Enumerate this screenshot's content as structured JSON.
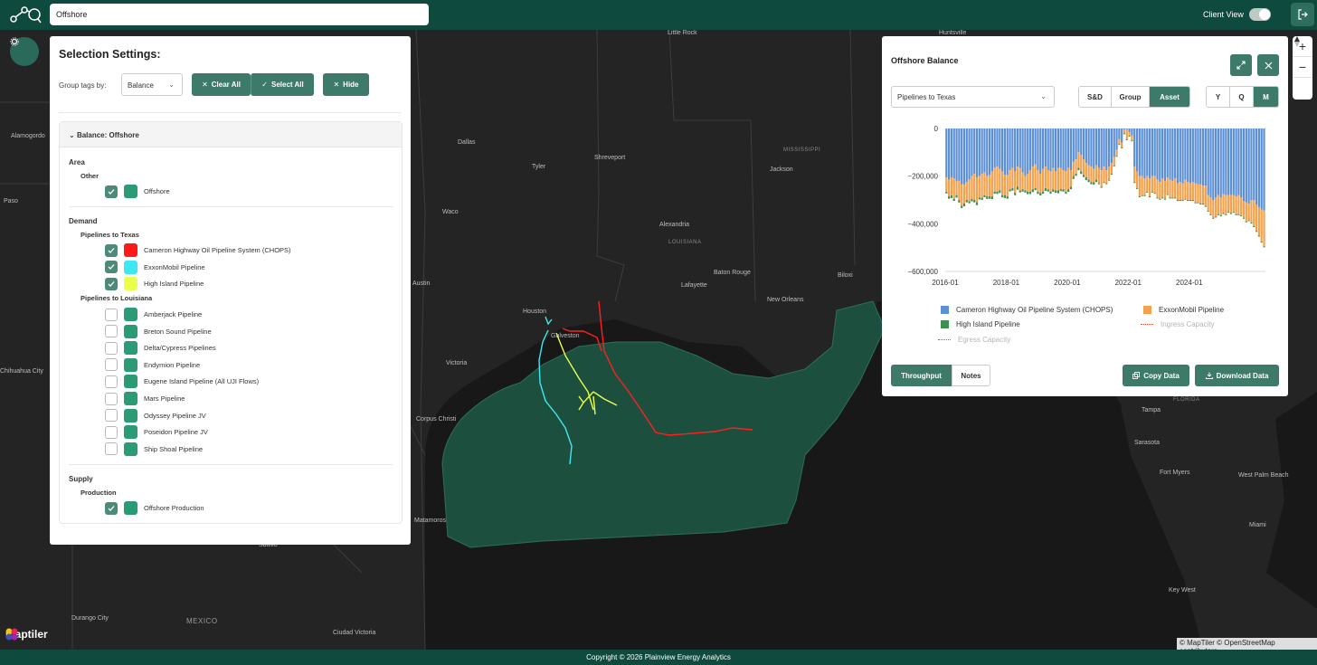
{
  "topbar": {
    "search_value": "Offshore",
    "client_view_label": "Client View",
    "client_view_on": true
  },
  "map": {
    "places": [
      {
        "name": "Little Rock",
        "x": 738,
        "y": 0
      },
      {
        "name": "Huntsville",
        "x": 1038,
        "y": 0
      },
      {
        "name": "Alamogordo",
        "x": 12,
        "y": 114
      },
      {
        "name": "Paso",
        "x": 4,
        "y": 186
      },
      {
        "name": "Dallas",
        "x": 506,
        "y": 121
      },
      {
        "name": "Tyler",
        "x": 588,
        "y": 148
      },
      {
        "name": "Shreveport",
        "x": 657,
        "y": 138
      },
      {
        "name": "MISSISSIPPI",
        "x": 866,
        "y": 130,
        "small": true
      },
      {
        "name": "Jackson",
        "x": 851,
        "y": 151
      },
      {
        "name": "Waco",
        "x": 489,
        "y": 198
      },
      {
        "name": "Alexandria",
        "x": 729,
        "y": 212
      },
      {
        "name": "LOUISIANA",
        "x": 739,
        "y": 232,
        "small": true
      },
      {
        "name": "Austin",
        "x": 456,
        "y": 277
      },
      {
        "name": "Lafayette",
        "x": 753,
        "y": 279
      },
      {
        "name": "Baton Rouge",
        "x": 789,
        "y": 265
      },
      {
        "name": "New Orleans",
        "x": 848,
        "y": 295
      },
      {
        "name": "Biloxi",
        "x": 926,
        "y": 268
      },
      {
        "name": "Houston",
        "x": 578,
        "y": 308
      },
      {
        "name": "Galveston",
        "x": 609,
        "y": 335
      },
      {
        "name": "Victoria",
        "x": 493,
        "y": 365
      },
      {
        "name": "Chihuahua City",
        "x": 0,
        "y": 374
      },
      {
        "name": "Corpus Christi",
        "x": 460,
        "y": 427
      },
      {
        "name": "Tampa",
        "x": 1262,
        "y": 417
      },
      {
        "name": "FLORIDA",
        "x": 1297,
        "y": 406,
        "small": true
      },
      {
        "name": "Sarasota",
        "x": 1254,
        "y": 453
      },
      {
        "name": "Fort Myers",
        "x": 1282,
        "y": 486
      },
      {
        "name": "West Palm Beach",
        "x": 1369,
        "y": 489
      },
      {
        "name": "Matamoros",
        "x": 458,
        "y": 539
      },
      {
        "name": "Miami",
        "x": 1381,
        "y": 544
      },
      {
        "name": "Key West",
        "x": 1292,
        "y": 616
      },
      {
        "name": "Saltillo",
        "x": 286,
        "y": 566
      },
      {
        "name": "Durango City",
        "x": 79,
        "y": 647
      },
      {
        "name": "MEXICO",
        "x": 206,
        "y": 649,
        "country": true
      },
      {
        "name": "Ciudad Victoria",
        "x": 368,
        "y": 663
      }
    ],
    "brand": "maptiler",
    "attribution": "© MapTiler © OpenStreetMap contributors"
  },
  "selection": {
    "title": "Selection Settings:",
    "group_label": "Group tags by:",
    "group_value": "Balance",
    "clear_all": "Clear All",
    "select_all": "Select All",
    "hide": "Hide",
    "section_header": "Balance: Offshore",
    "area_label": "Area",
    "area_other": "Other",
    "area_items": [
      {
        "label": "Offshore",
        "checked": true,
        "color": "#2a9b73"
      }
    ],
    "demand_label": "Demand",
    "texas_label": "Pipelines to Texas",
    "texas_items": [
      {
        "label": "Cameron Highway Oil Pipeline System (CHOPS)",
        "checked": true,
        "color": "#ff1a1a"
      },
      {
        "label": "ExxonMobil Pipeline",
        "checked": true,
        "color": "#3de8f2"
      },
      {
        "label": "High Island Pipeline",
        "checked": true,
        "color": "#eaff4a"
      }
    ],
    "louisiana_label": "Pipelines to Louisiana",
    "louisiana_items": [
      {
        "label": "Amberjack Pipeline",
        "checked": false,
        "color": "#2a9b73"
      },
      {
        "label": "Breton Sound Pipeline",
        "checked": false,
        "color": "#2a9b73"
      },
      {
        "label": "Delta/Cypress Pipelines",
        "checked": false,
        "color": "#2a9b73"
      },
      {
        "label": "Endymion Pipeline",
        "checked": false,
        "color": "#2a9b73"
      },
      {
        "label": "Eugene Island Pipeline (All UJI Flows)",
        "checked": false,
        "color": "#2a9b73"
      },
      {
        "label": "Mars Pipeline",
        "checked": false,
        "color": "#2a9b73"
      },
      {
        "label": "Odyssey Pipeline JV",
        "checked": false,
        "color": "#2a9b73"
      },
      {
        "label": "Poseidon Pipeline JV",
        "checked": false,
        "color": "#2a9b73"
      },
      {
        "label": "Ship Shoal Pipeline",
        "checked": false,
        "color": "#2a9b73"
      }
    ],
    "supply_label": "Supply",
    "production_label": "Production",
    "production_items": [
      {
        "label": "Offshore Production",
        "checked": true,
        "color": "#2a9b73"
      }
    ]
  },
  "chart_panel": {
    "title": "Offshore Balance",
    "select_value": "Pipelines to Texas",
    "view_tabs": [
      {
        "label": "S&D",
        "active": false
      },
      {
        "label": "Group",
        "active": false
      },
      {
        "label": "Asset",
        "active": true
      }
    ],
    "period_tabs": [
      {
        "label": "Y",
        "active": false
      },
      {
        "label": "Q",
        "active": false
      },
      {
        "label": "M",
        "active": true
      }
    ],
    "throughput": "Throughput",
    "notes": "Notes",
    "copy_data": "Copy Data",
    "download_data": "Download Data"
  },
  "chart_data": {
    "type": "bar",
    "stacked": true,
    "x_ticks": [
      "2016-01",
      "2018-01",
      "2020-01",
      "2022-01",
      "2024-01"
    ],
    "y_ticks": [
      0,
      -200000,
      -400000,
      -600000
    ],
    "y_tick_labels": [
      "0",
      "−200,000",
      "−400,000",
      "−600,000"
    ],
    "ylim": [
      -600000,
      0
    ],
    "x_start": "2016-01",
    "x_end": "2024-10",
    "series": [
      {
        "name": "Cameron Highway Oil Pipeline System (CHOPS)",
        "color": "#5b8fd6",
        "values": [
          -205000,
          -215000,
          -205000,
          -210000,
          -220000,
          -220000,
          -235000,
          -235000,
          -225000,
          -215000,
          -200000,
          -190000,
          -205000,
          -200000,
          -190000,
          -185000,
          -200000,
          -195000,
          -180000,
          -165000,
          -160000,
          -170000,
          -180000,
          -195000,
          -195000,
          -175000,
          -165000,
          -180000,
          -160000,
          -165000,
          -185000,
          -200000,
          -190000,
          -175000,
          -160000,
          -150000,
          -175000,
          -190000,
          -170000,
          -160000,
          -175000,
          -180000,
          -165000,
          -180000,
          -165000,
          -165000,
          -175000,
          -180000,
          -165000,
          -175000,
          -140000,
          -130000,
          -100000,
          -110000,
          -130000,
          -145000,
          -155000,
          -160000,
          -170000,
          -155000,
          -165000,
          -175000,
          -160000,
          -175000,
          -160000,
          -145000,
          -120000,
          -90000,
          -45000,
          -60000,
          -5000,
          -5000,
          -15000,
          -30000,
          -160000,
          -180000,
          -200000,
          -200000,
          -210000,
          -200000,
          -210000,
          -200000,
          -200000,
          -215000,
          -225000,
          -210000,
          -220000,
          -205000,
          -215000,
          -220000,
          -210000,
          -230000,
          -225000,
          -230000,
          -215000,
          -225000,
          -230000,
          -225000,
          -230000,
          -235000,
          -235000,
          -240000,
          -240000,
          -280000,
          -290000,
          -300000,
          -290000,
          -280000,
          -290000,
          -275000,
          -280000,
          -280000,
          -280000,
          -280000,
          -285000,
          -280000,
          -290000,
          -305000,
          -310000,
          -315000,
          -300000,
          -300000,
          -320000,
          -330000,
          -340000,
          -345000
        ]
      },
      {
        "name": "ExxonMobil Pipeline",
        "color": "#f3a14c",
        "values": [
          -60000,
          -70000,
          -75000,
          -85000,
          -60000,
          -80000,
          -90000,
          -80000,
          -75000,
          -90000,
          -95000,
          -110000,
          -105000,
          -90000,
          -100000,
          -95000,
          -85000,
          -90000,
          -105000,
          -100000,
          -105000,
          -90000,
          -100000,
          -85000,
          -90000,
          -80000,
          -85000,
          -90000,
          -85000,
          -95000,
          -70000,
          -60000,
          -75000,
          -90000,
          -95000,
          -100000,
          -90000,
          -80000,
          -95000,
          -90000,
          -80000,
          -85000,
          -90000,
          -80000,
          -95000,
          -90000,
          -80000,
          -85000,
          -90000,
          -70000,
          -60000,
          -60000,
          -65000,
          -70000,
          -65000,
          -60000,
          -60000,
          -65000,
          -55000,
          -60000,
          -65000,
          -70000,
          -65000,
          -55000,
          -55000,
          -45000,
          -35000,
          -25000,
          -20000,
          -20000,
          -15000,
          -40000,
          -15000,
          -20000,
          -65000,
          -70000,
          -85000,
          -80000,
          -70000,
          -65000,
          -75000,
          -65000,
          -70000,
          -75000,
          -70000,
          -80000,
          -75000,
          -70000,
          -75000,
          -70000,
          -80000,
          -70000,
          -75000,
          -70000,
          -80000,
          -75000,
          -70000,
          -75000,
          -80000,
          -75000,
          -80000,
          -75000,
          -85000,
          -65000,
          -70000,
          -75000,
          -80000,
          -80000,
          -75000,
          -80000,
          -80000,
          -70000,
          -75000,
          -70000,
          -75000,
          -80000,
          -75000,
          -70000,
          -80000,
          -70000,
          -95000,
          -110000,
          -110000,
          -120000,
          -135000,
          -150000
        ]
      },
      {
        "name": "High Island Pipeline",
        "color": "#3f8f52",
        "values": [
          -8000,
          -10000,
          -12000,
          -9000,
          -10000,
          -11000,
          -9000,
          -12000,
          -10000,
          -9000,
          -11000,
          -10000,
          -12000,
          -8000,
          -10000,
          -9000,
          -11000,
          -10000,
          -12000,
          -9000,
          -10000,
          -11000,
          -9000,
          -12000,
          -10000,
          -9000,
          -11000,
          -10000,
          -12000,
          -8000,
          -10000,
          -9000,
          -11000,
          -10000,
          -12000,
          -9000,
          -10000,
          -11000,
          -9000,
          -12000,
          -10000,
          -9000,
          -11000,
          -10000,
          -12000,
          -8000,
          -10000,
          -9000,
          -11000,
          -10000,
          -12000,
          -9000,
          -10000,
          -11000,
          -9000,
          -12000,
          -10000,
          -9000,
          -11000,
          -10000,
          -4000,
          -4000,
          -4000,
          -4000,
          -4000,
          -4000,
          -4000,
          -4000,
          -4000,
          -4000,
          -4000,
          -4000,
          -4000,
          -4000,
          -4000,
          -4000,
          -4000,
          -4000,
          -4000,
          -4000,
          -4000,
          -4000,
          -4000,
          -4000,
          -4000,
          -4000,
          -4000,
          -4000,
          -4000,
          -4000,
          -4000,
          -4000,
          -4000,
          -4000,
          -4000,
          -4000,
          -4000,
          -4000,
          -4000,
          -4000,
          -4000,
          -4000,
          -4000,
          -4000,
          -4000,
          -4000,
          -4000,
          -4000,
          -4000,
          -4000,
          -4000,
          -4000,
          -4000,
          -4000,
          -4000,
          -4000,
          -4000,
          -4000,
          -4000,
          -4000,
          -4000,
          -4000,
          -4000,
          -4000,
          -4000,
          -4000
        ]
      },
      {
        "name": "Ingress Capacity",
        "color": "#d14b3a",
        "values": [],
        "style": "dotted",
        "hidden": true
      },
      {
        "name": "Egress Capacity",
        "color": "#d14b3a",
        "values": [],
        "style": "dotted",
        "hidden": true
      }
    ],
    "legend_placement": "bottom"
  },
  "footer": {
    "copyright": "Copyright © 2026 Plainview Energy Analytics"
  },
  "colors": {
    "brand_dark": "#0e4a3d",
    "brand_button": "#3e7a6a",
    "map_land": "#242424",
    "offshore_area": "#1d4f3f"
  }
}
